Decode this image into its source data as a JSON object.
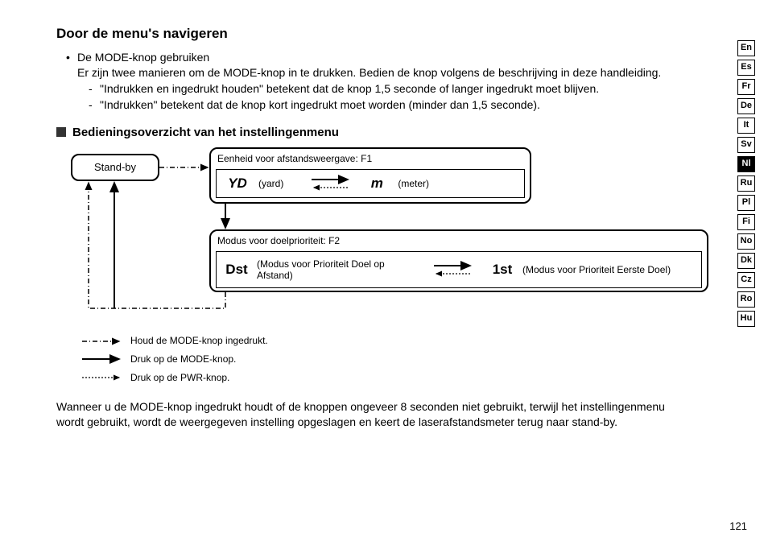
{
  "title": "Door de menu's navigeren",
  "bullet": {
    "head": "De MODE-knop gebruiken",
    "body": "Er zijn twee manieren om de MODE-knop in te drukken. Bedien de knop volgens de beschrijving in deze handleiding.",
    "sub1": "\"Indrukken en ingedrukt houden\" betekent dat de knop 1,5 seconde of langer ingedrukt moet blijven.",
    "sub2": "\"Indrukken\" betekent dat de knop kort ingedrukt moet worden (minder dan 1,5 seconde)."
  },
  "section_title": "Bedieningsoverzicht van het instellingenmenu",
  "diagram": {
    "standby": "Stand-by",
    "f1_title": "Eenheid voor afstandsweergave: F1",
    "f1_yd": "YD",
    "f1_yd_lbl": "(yard)",
    "f1_m": "m",
    "f1_m_lbl": "(meter)",
    "f2_title": "Modus voor doelprioriteit: F2",
    "f2_dst": "Dst",
    "f2_dst_lbl": "(Modus voor Prioriteit Doel op Afstand)",
    "f2_1st": "1st",
    "f2_1st_lbl": "(Modus voor Prioriteit Eerste Doel)"
  },
  "legend": {
    "hold": "Houd de MODE-knop ingedrukt.",
    "press_mode": "Druk op de MODE-knop.",
    "press_pwr": "Druk op de PWR-knop."
  },
  "bottom": "Wanneer u de MODE-knop ingedrukt houdt of de knoppen ongeveer 8 seconden niet gebruikt, terwijl het instellingenmenu wordt gebruikt, wordt de weergegeven instelling opgeslagen en keert de laserafstandsmeter terug naar stand-by.",
  "page_number": "121",
  "languages": [
    "En",
    "Es",
    "Fr",
    "De",
    "It",
    "Sv",
    "Nl",
    "Ru",
    "Pl",
    "Fi",
    "No",
    "Dk",
    "Cz",
    "Ro",
    "Hu"
  ],
  "active_lang": "Nl"
}
